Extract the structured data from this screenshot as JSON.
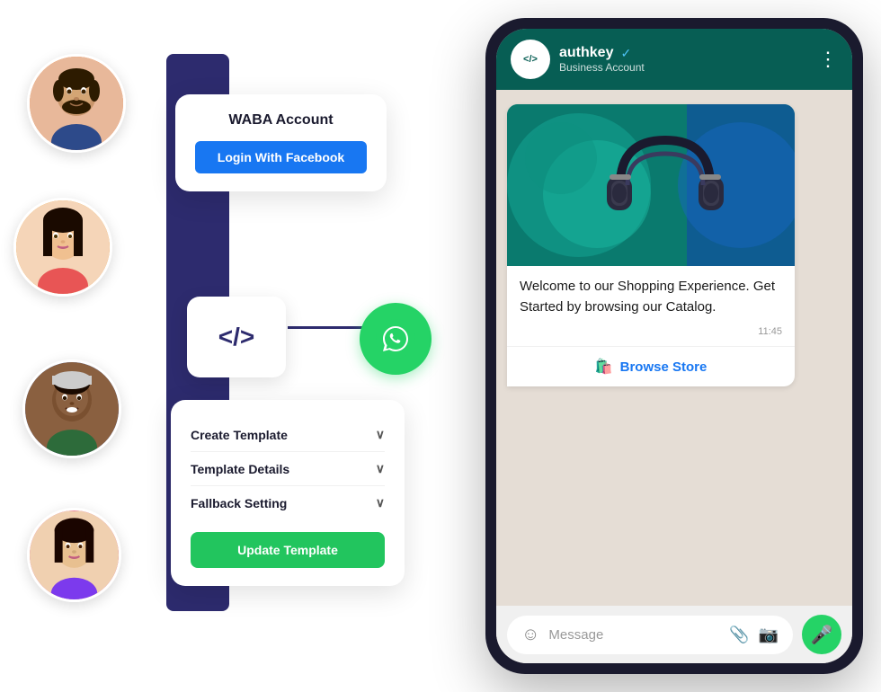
{
  "scene": {
    "background": "#ffffff"
  },
  "avatars": [
    {
      "id": "avatar-1",
      "colorClass": "av1",
      "emoji": "👨‍🦱"
    },
    {
      "id": "avatar-2",
      "colorClass": "av2",
      "emoji": "👩"
    },
    {
      "id": "avatar-3",
      "colorClass": "av3",
      "emoji": "👨🏾"
    },
    {
      "id": "avatar-4",
      "colorClass": "av4",
      "emoji": "👩🏻"
    }
  ],
  "waba_card": {
    "title": "WABA Account",
    "button_label": "Login With Facebook"
  },
  "code_box": {
    "text": "</>"
  },
  "template_card": {
    "rows": [
      {
        "label": "Create Template",
        "chevron": "∨"
      },
      {
        "label": "Template Details",
        "chevron": "∨"
      },
      {
        "label": "Fallback Setting",
        "chevron": "∨"
      }
    ],
    "button_label": "Update Template"
  },
  "phone": {
    "header": {
      "logo_text": "</>",
      "name": "authkey",
      "verified_icon": "✓",
      "subtitle": "Business Account",
      "menu_icon": "⋮"
    },
    "message": {
      "text": "Welcome to our Shopping Experience. Get Started by browsing our Catalog.",
      "time": "11:45",
      "action_icon": "🛍",
      "action_label": "Browse Store"
    },
    "input": {
      "emoji_icon": "☺",
      "placeholder": "Message",
      "attach_icon": "📎",
      "camera_icon": "📷",
      "mic_icon": "🎤"
    }
  }
}
